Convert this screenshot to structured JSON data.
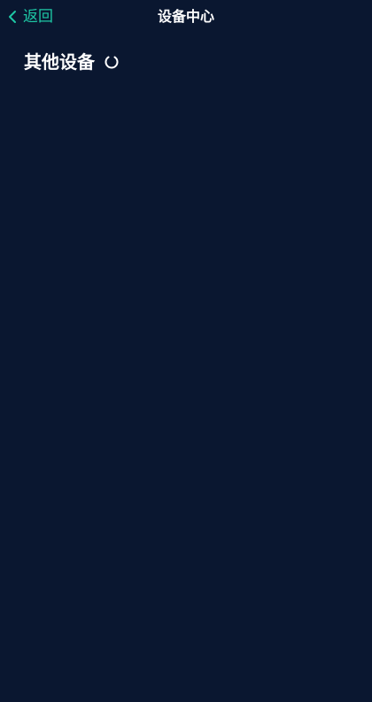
{
  "nav": {
    "back_label": "返回",
    "title": "设备中心",
    "back_icon": "chevron-left-icon"
  },
  "section": {
    "title": "其他设备",
    "loading_icon": "loading-spinner-icon"
  },
  "colors": {
    "background": "#0a1730",
    "accent": "#1ec8a5",
    "text": "#ffffff"
  }
}
